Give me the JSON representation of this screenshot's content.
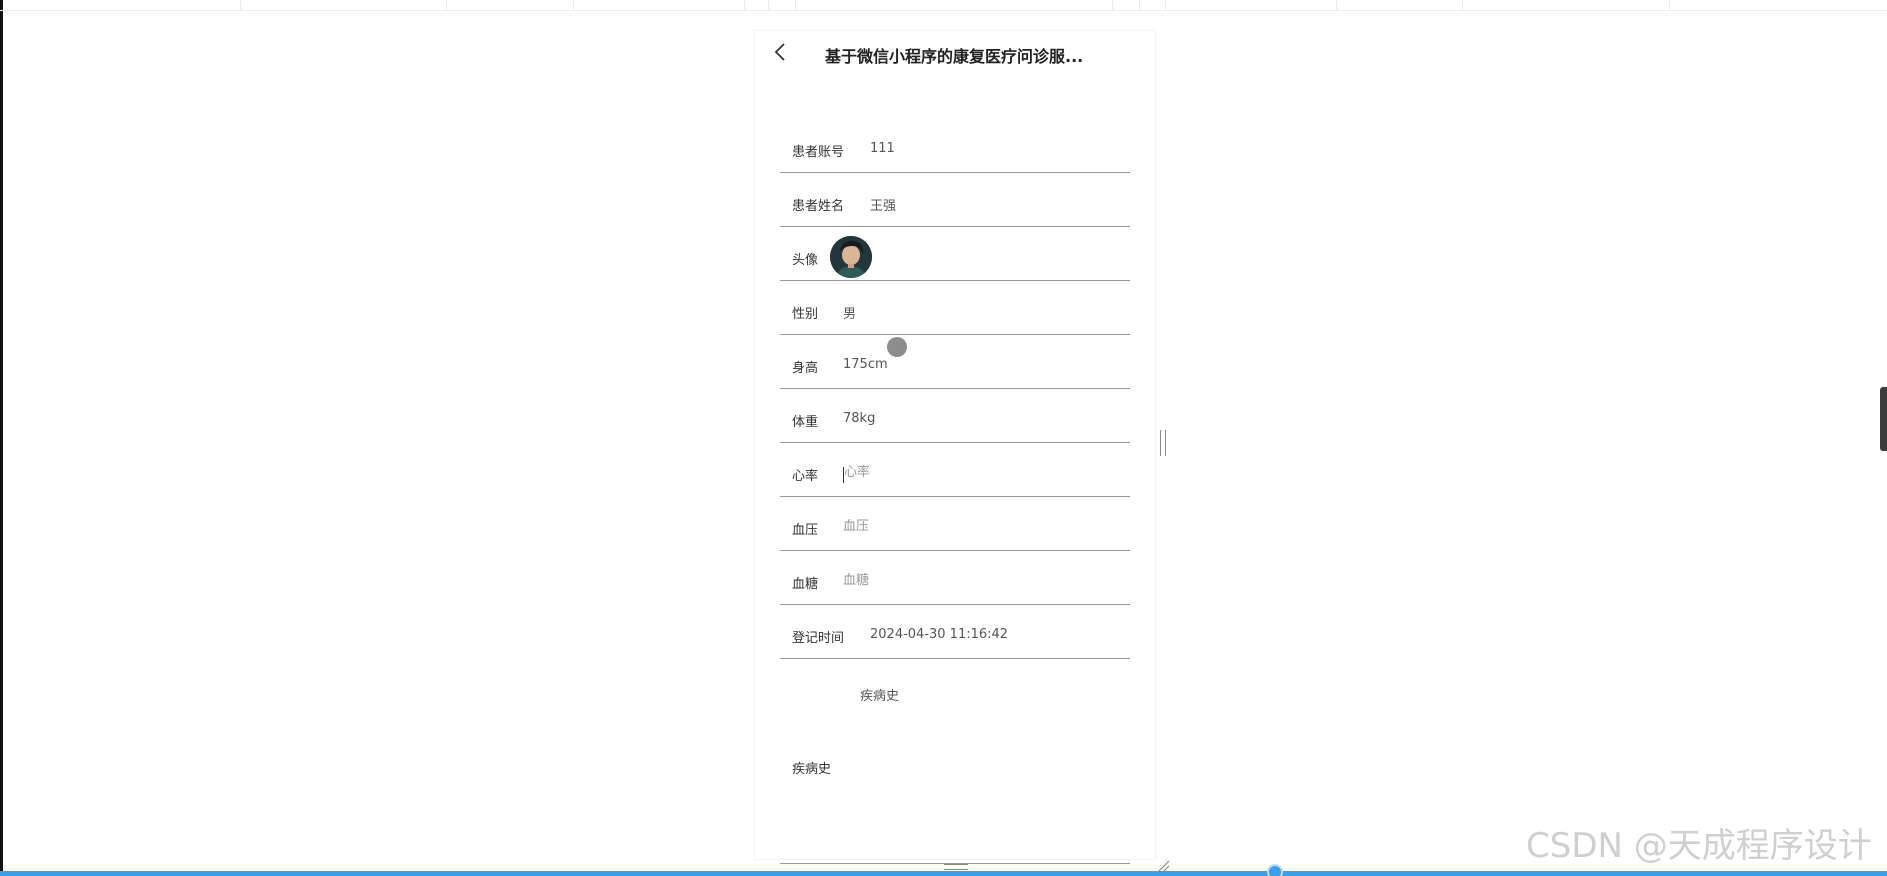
{
  "app": {
    "title": "基于微信小程序的康复医疗问诊服..."
  },
  "form": {
    "account": {
      "label": "患者账号",
      "value": "111"
    },
    "name": {
      "label": "患者姓名",
      "value": "王强"
    },
    "avatar": {
      "label": "头像"
    },
    "gender": {
      "label": "性别",
      "value": "男"
    },
    "height": {
      "label": "身高",
      "value": "175cm"
    },
    "weight": {
      "label": "体重",
      "value": "78kg"
    },
    "heart_rate": {
      "label": "心率",
      "placeholder": "心率"
    },
    "blood_pressure": {
      "label": "血压",
      "placeholder": "血压"
    },
    "blood_sugar": {
      "label": "血糖",
      "placeholder": "血糖"
    },
    "register_time": {
      "label": "登记时间",
      "value": "2024-04-30 11:16:42"
    },
    "medical_history": {
      "caption": "疾病史",
      "label": "疾病史"
    }
  },
  "watermark": "CSDN @天成程序设计",
  "colors": {
    "accent": "#3a9eea",
    "divider": "#999999"
  },
  "icons": {
    "back": "chevron-left-icon",
    "resize": "resize-corner-icon"
  }
}
